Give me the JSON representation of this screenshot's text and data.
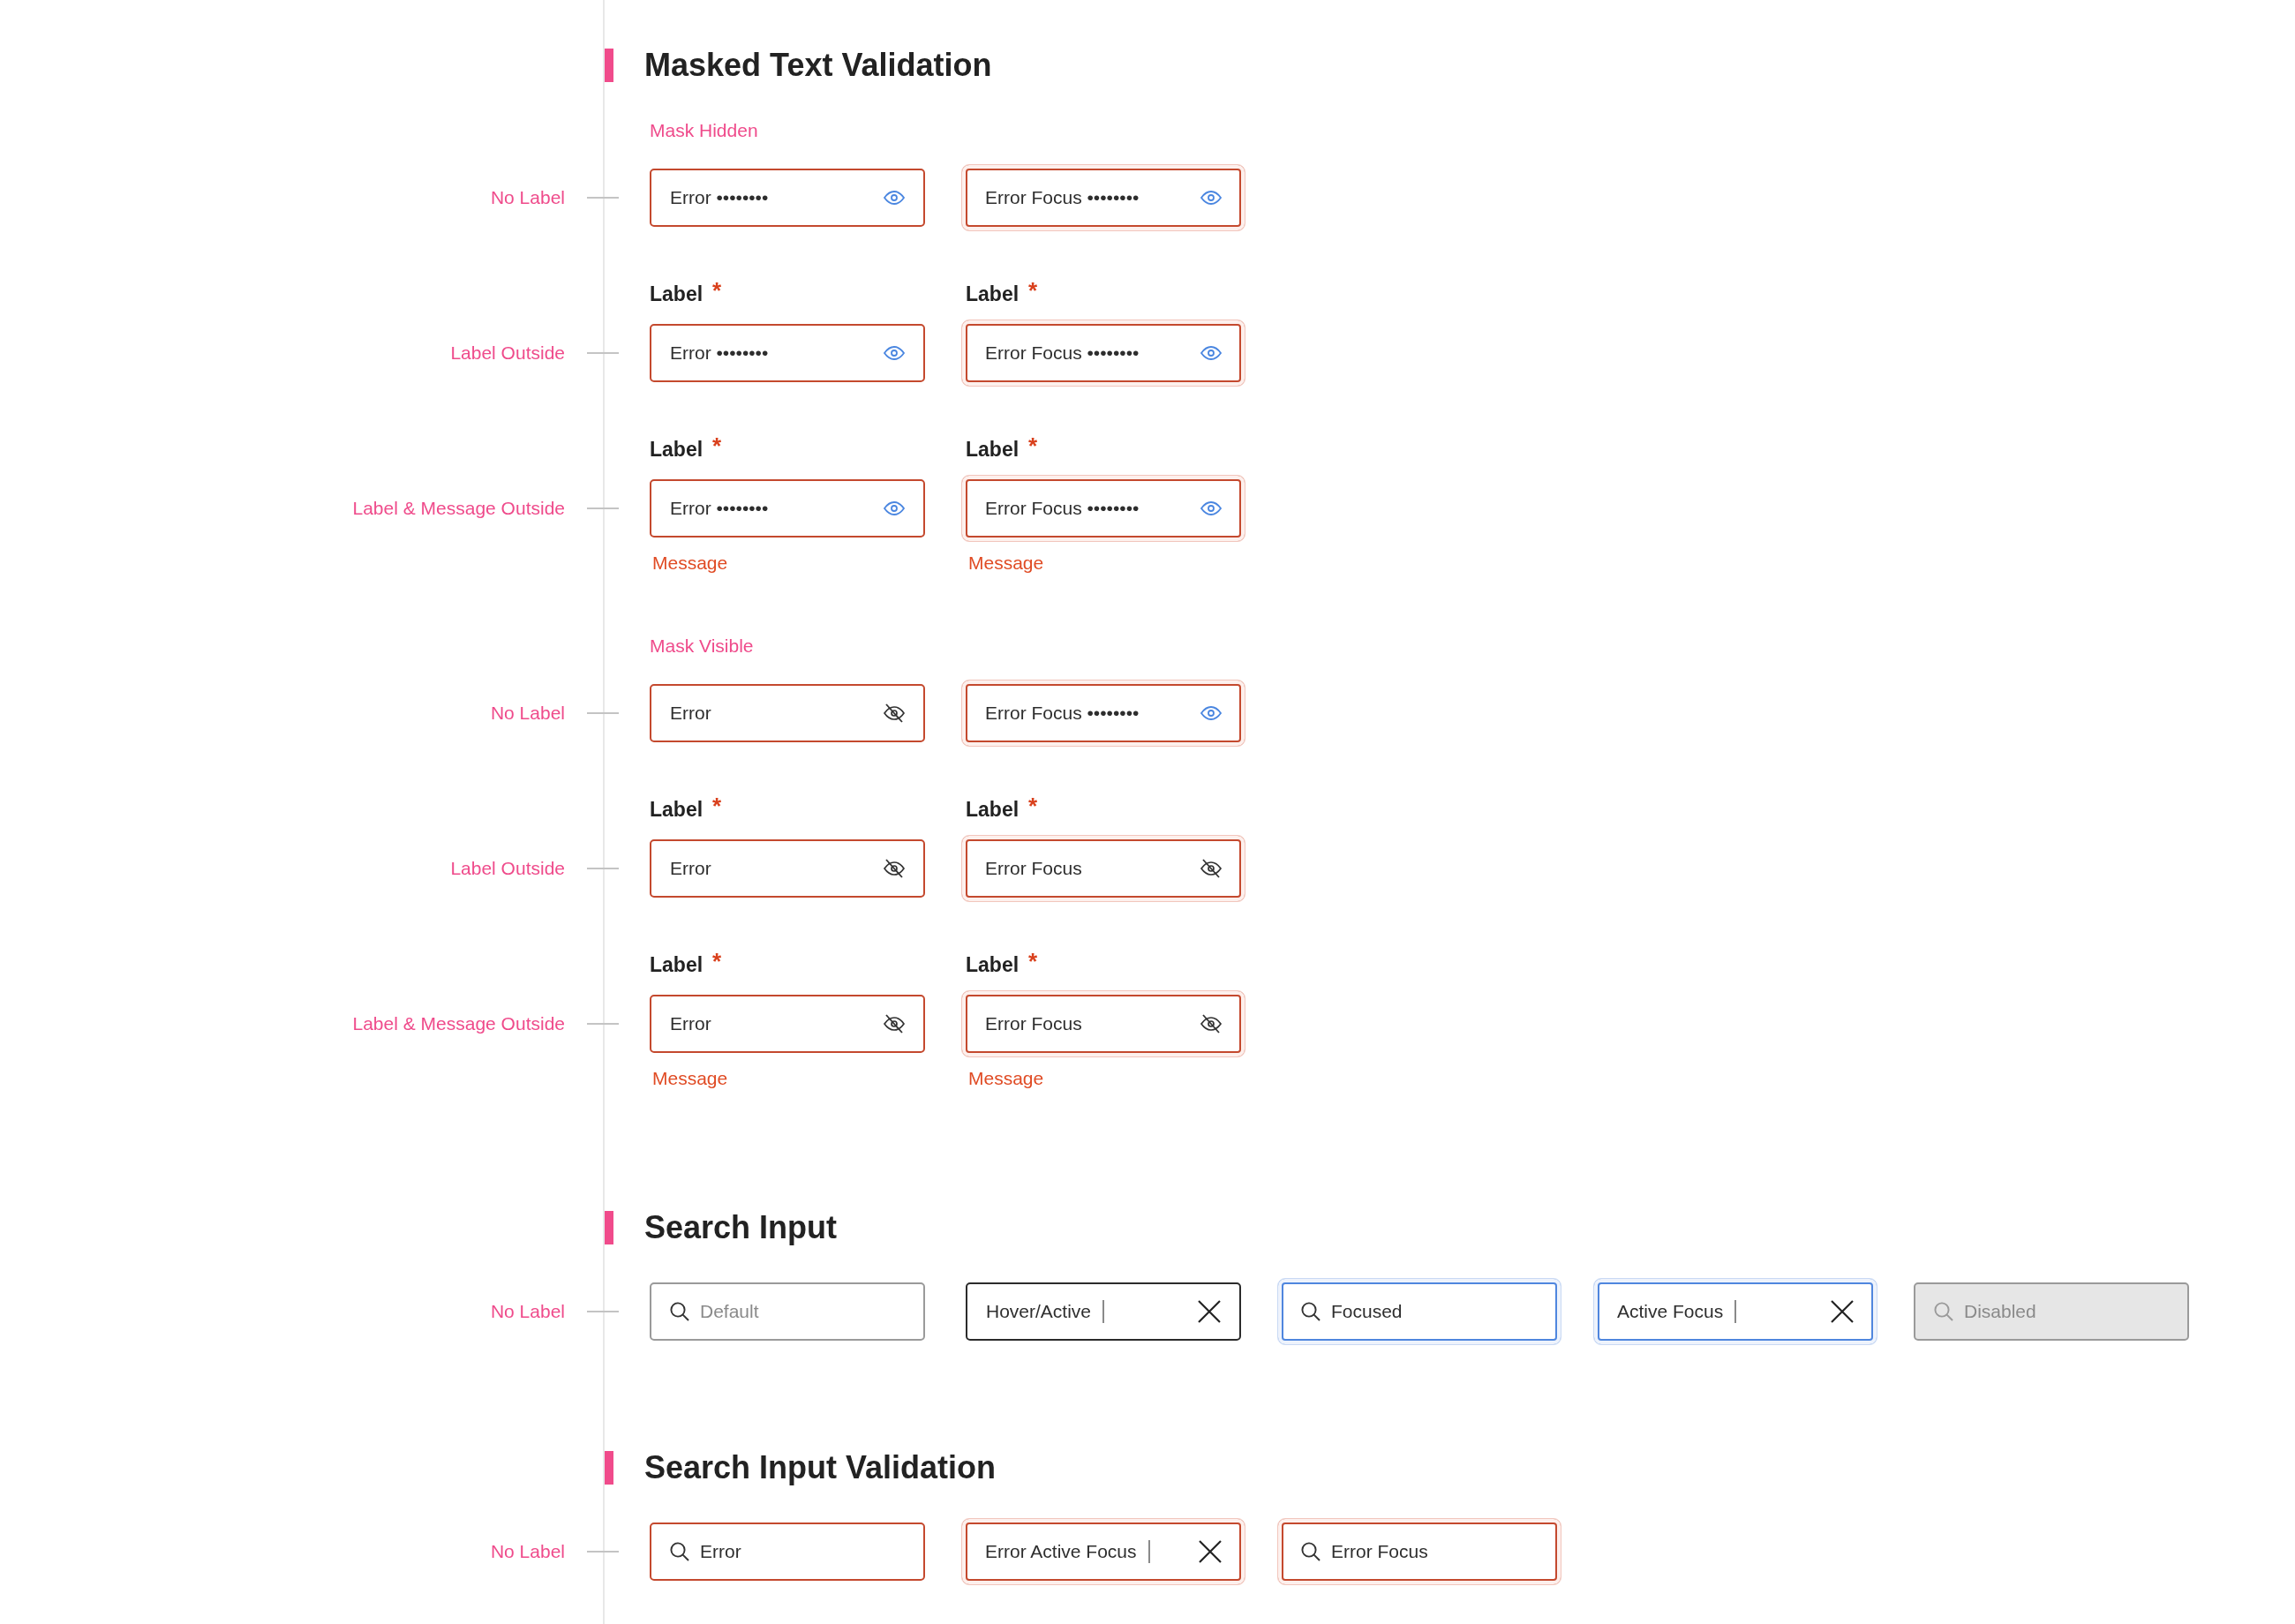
{
  "sections": [
    {
      "title": "Masked Text Validation",
      "groups": [
        {
          "title": "Mask Hidden",
          "rows": [
            {
              "label": "No Label",
              "fields": [
                {
                  "kind": "masked",
                  "value": "Error ••••••••",
                  "masked": true,
                  "error": true,
                  "focused": false
                },
                {
                  "kind": "masked",
                  "value": "Error Focus ••••••••",
                  "masked": true,
                  "error": true,
                  "focused": true
                }
              ]
            },
            {
              "label": "Label Outside",
              "fields": [
                {
                  "kind": "masked",
                  "label": "Label",
                  "required_mark": "*",
                  "value": "Error ••••••••",
                  "masked": true,
                  "error": true,
                  "focused": false
                },
                {
                  "kind": "masked",
                  "label": "Label",
                  "required_mark": "*",
                  "value": "Error Focus ••••••••",
                  "masked": true,
                  "error": true,
                  "focused": true
                }
              ]
            },
            {
              "label": "Label & Message Outside",
              "fields": [
                {
                  "kind": "masked",
                  "label": "Label",
                  "required_mark": "*",
                  "value": "Error ••••••••",
                  "masked": true,
                  "error": true,
                  "focused": false,
                  "message": "Message"
                },
                {
                  "kind": "masked",
                  "label": "Label",
                  "required_mark": "*",
                  "value": "Error Focus ••••••••",
                  "masked": true,
                  "error": true,
                  "focused": true,
                  "message": "Message"
                }
              ]
            }
          ]
        },
        {
          "title": "Mask Visible",
          "rows": [
            {
              "label": "No Label",
              "fields": [
                {
                  "kind": "masked",
                  "value": "Error",
                  "masked": false,
                  "error": true,
                  "focused": false
                },
                {
                  "kind": "masked",
                  "value": "Error Focus ••••••••",
                  "masked": true,
                  "error": true,
                  "focused": true
                }
              ]
            },
            {
              "label": "Label Outside",
              "fields": [
                {
                  "kind": "masked",
                  "label": "Label",
                  "required_mark": "*",
                  "value": "Error",
                  "masked": false,
                  "error": true,
                  "focused": false
                },
                {
                  "kind": "masked",
                  "label": "Label",
                  "required_mark": "*",
                  "value": "Error Focus",
                  "masked": false,
                  "error": true,
                  "focused": true
                }
              ]
            },
            {
              "label": "Label & Message Outside",
              "fields": [
                {
                  "kind": "masked",
                  "label": "Label",
                  "required_mark": "*",
                  "value": "Error",
                  "masked": false,
                  "error": true,
                  "focused": false,
                  "message": "Message"
                },
                {
                  "kind": "masked",
                  "label": "Label",
                  "required_mark": "*",
                  "value": "Error Focus",
                  "masked": false,
                  "error": true,
                  "focused": true,
                  "message": "Message"
                }
              ]
            }
          ]
        }
      ]
    },
    {
      "title": "Search Input",
      "groups": [
        {
          "rows": [
            {
              "label": "No Label",
              "fields": [
                {
                  "kind": "search",
                  "placeholder": "Default",
                  "error": false,
                  "focused": false,
                  "hovered": false,
                  "disabled": false,
                  "active": false
                },
                {
                  "kind": "search",
                  "value": "Hover/Active",
                  "error": false,
                  "focused": false,
                  "hovered": true,
                  "disabled": false,
                  "active": true
                },
                {
                  "kind": "search",
                  "value": "Focused",
                  "error": false,
                  "focused": true,
                  "hovered": false,
                  "disabled": false,
                  "active": false
                },
                {
                  "kind": "search",
                  "value": "Active Focus",
                  "error": false,
                  "focused": true,
                  "hovered": false,
                  "disabled": false,
                  "active": true
                },
                {
                  "kind": "search",
                  "placeholder": "Disabled",
                  "error": false,
                  "focused": false,
                  "hovered": false,
                  "disabled": true,
                  "active": false
                }
              ]
            }
          ]
        }
      ]
    },
    {
      "title": "Search Input Validation",
      "groups": [
        {
          "rows": [
            {
              "label": "No Label",
              "fields": [
                {
                  "kind": "search",
                  "value": "Error",
                  "error": true,
                  "focused": false,
                  "active": false
                },
                {
                  "kind": "search",
                  "value": "Error Active Focus",
                  "error": true,
                  "focused": true,
                  "active": true
                },
                {
                  "kind": "search",
                  "value": "Error Focus",
                  "error": true,
                  "focused": true,
                  "active": false
                }
              ]
            }
          ]
        }
      ]
    }
  ]
}
